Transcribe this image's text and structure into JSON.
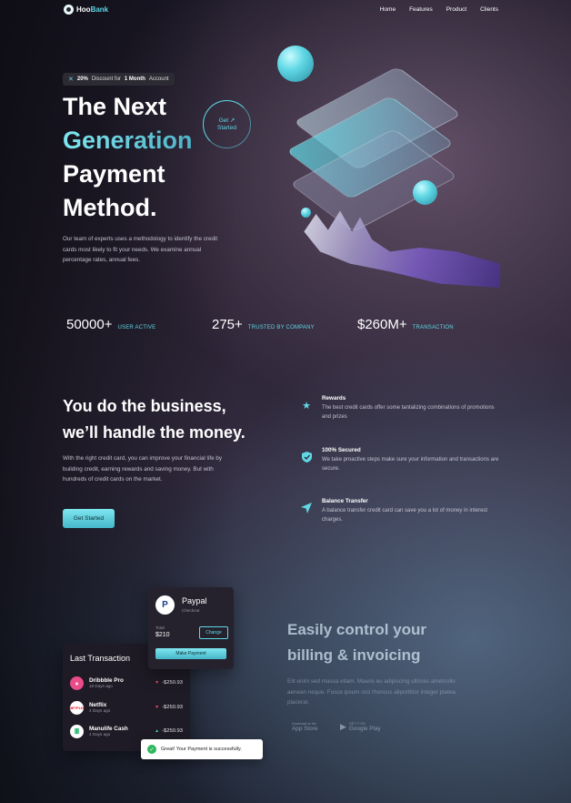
{
  "nav": {
    "logo_part1": "Hoo",
    "logo_part2": "Bank",
    "links": [
      "Home",
      "Features",
      "Product",
      "Clients"
    ]
  },
  "hero": {
    "badge_percent": "20%",
    "badge_text": "Discount for",
    "badge_bold": "1 Month",
    "badge_tail": "Account",
    "title_line1": "The Next",
    "title_line2": "Generation",
    "title_line3": "Payment",
    "title_line4": "Method.",
    "cta_line1": "Get",
    "cta_line2": "Started",
    "cta_arrow": "↗",
    "description": "Our team of experts uses a methodology to identify the credit cards most likely to fit your needs. We examine annual percentage rates, annual fees."
  },
  "stats": [
    {
      "value": "50000+",
      "label": "USER ACTIVE"
    },
    {
      "value": "275+",
      "label": "TRUSTED BY COMPANY"
    },
    {
      "value": "$260M+",
      "label": "TRANSACTION"
    }
  ],
  "business": {
    "title_line1": "You do the business,",
    "title_line2": "we’ll handle the money.",
    "description": "With the right credit card, you can improve your financial life by building credit, earning rewards and saving money. But with hundreds of credit cards on the market.",
    "button": "Get Started",
    "features": [
      {
        "icon": "star-icon",
        "title": "Rewards",
        "desc": "The best credit cards offer some tantalizing combinations of promotions and prizes"
      },
      {
        "icon": "shield-icon",
        "title": "100% Secured",
        "desc": "We take proactive steps make sure your information and transactions are secure."
      },
      {
        "icon": "send-icon",
        "title": "Balance Transfer",
        "desc": "A balance transfer credit card can save you a lot of money in interest charges."
      }
    ]
  },
  "billing": {
    "transactions_title": "Last Transaction",
    "transactions": [
      {
        "name": "Dribbble Pro",
        "date": "18 Days ago",
        "amount": "-$250.93",
        "direction": "down",
        "logo": "dribbble-icon"
      },
      {
        "name": "Netflix",
        "date": "4 Days ago",
        "amount": "-$250.93",
        "direction": "down",
        "logo": "netflix-icon",
        "logo_text": "NETFLIX"
      },
      {
        "name": "Manulife Cash",
        "date": "4 Days ago",
        "amount": "-$250.93",
        "direction": "up",
        "logo": "manulife-icon"
      }
    ],
    "paypal": {
      "name": "Paypal",
      "sub": "Checkout",
      "total_label": "Total",
      "total": "$210",
      "change": "Change",
      "make_payment": "Make Payment"
    },
    "toast": "Great! Your Payment is successfully.",
    "title_line1": "Easily control your",
    "title_line2": "billing & invoicing",
    "description": "Elit enim sed massa etiam. Mauris eu adipiscing ultrices ametcollo aenean neque. Fusce ipsum orci rhoncus aliporttitor integer platea placerat.",
    "app_store_small": "Download on the",
    "app_store": "App Store",
    "google_play_small": "GET IT ON",
    "google_play": "Google Play"
  }
}
